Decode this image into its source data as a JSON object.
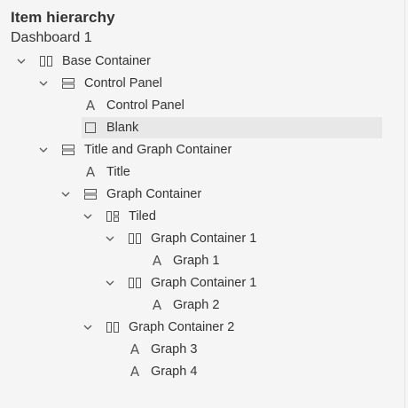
{
  "header": {
    "title": "Item hierarchy",
    "subtitle": "Dashboard 1"
  },
  "tree": [
    {
      "label": "Base Container",
      "icon": "horizontal-container-icon",
      "expanded": true,
      "depth": 0
    },
    {
      "label": "Control Panel",
      "icon": "vertical-container-icon",
      "expanded": true,
      "depth": 1
    },
    {
      "label": "Control Panel",
      "icon": "text-object-icon",
      "expanded": null,
      "depth": 2
    },
    {
      "label": "Blank",
      "icon": "blank-object-icon",
      "expanded": null,
      "depth": 2,
      "selected": true
    },
    {
      "label": "Title and Graph Container",
      "icon": "vertical-container-icon",
      "expanded": true,
      "depth": 1
    },
    {
      "label": "Title",
      "icon": "text-object-icon",
      "expanded": null,
      "depth": 2
    },
    {
      "label": "Graph Container",
      "icon": "vertical-container-icon",
      "expanded": true,
      "depth": 2
    },
    {
      "label": "Tiled",
      "icon": "tiled-container-icon",
      "expanded": true,
      "depth": 3
    },
    {
      "label": "Graph Container 1",
      "icon": "horizontal-container-icon",
      "expanded": true,
      "depth": 4
    },
    {
      "label": "Graph 1",
      "icon": "text-object-icon",
      "expanded": null,
      "depth": 5
    },
    {
      "label": "Graph Container 1",
      "icon": "horizontal-container-icon",
      "expanded": true,
      "depth": 4
    },
    {
      "label": "Graph 2",
      "icon": "text-object-icon",
      "expanded": null,
      "depth": 5
    },
    {
      "label": "Graph Container 2",
      "icon": "horizontal-container-icon",
      "expanded": true,
      "depth": 3
    },
    {
      "label": "Graph 3",
      "icon": "text-object-icon",
      "expanded": null,
      "depth": 4
    },
    {
      "label": "Graph 4",
      "icon": "text-object-icon",
      "expanded": null,
      "depth": 4
    }
  ],
  "colors": {
    "text": "#333333",
    "icon": "#555555",
    "selected_bg": "#e8e8e8",
    "panel_bg": "#f5f5f5"
  }
}
